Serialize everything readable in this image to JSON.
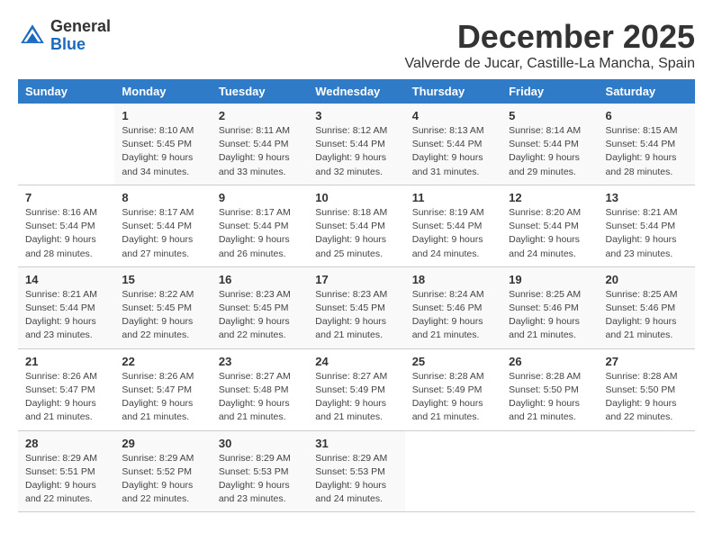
{
  "header": {
    "logo_general": "General",
    "logo_blue": "Blue",
    "month": "December 2025",
    "location": "Valverde de Jucar, Castille-La Mancha, Spain"
  },
  "days_of_week": [
    "Sunday",
    "Monday",
    "Tuesday",
    "Wednesday",
    "Thursday",
    "Friday",
    "Saturday"
  ],
  "weeks": [
    [
      {
        "day": "",
        "info": ""
      },
      {
        "day": "1",
        "info": "Sunrise: 8:10 AM\nSunset: 5:45 PM\nDaylight: 9 hours\nand 34 minutes."
      },
      {
        "day": "2",
        "info": "Sunrise: 8:11 AM\nSunset: 5:44 PM\nDaylight: 9 hours\nand 33 minutes."
      },
      {
        "day": "3",
        "info": "Sunrise: 8:12 AM\nSunset: 5:44 PM\nDaylight: 9 hours\nand 32 minutes."
      },
      {
        "day": "4",
        "info": "Sunrise: 8:13 AM\nSunset: 5:44 PM\nDaylight: 9 hours\nand 31 minutes."
      },
      {
        "day": "5",
        "info": "Sunrise: 8:14 AM\nSunset: 5:44 PM\nDaylight: 9 hours\nand 29 minutes."
      },
      {
        "day": "6",
        "info": "Sunrise: 8:15 AM\nSunset: 5:44 PM\nDaylight: 9 hours\nand 28 minutes."
      }
    ],
    [
      {
        "day": "7",
        "info": "Sunrise: 8:16 AM\nSunset: 5:44 PM\nDaylight: 9 hours\nand 28 minutes."
      },
      {
        "day": "8",
        "info": "Sunrise: 8:17 AM\nSunset: 5:44 PM\nDaylight: 9 hours\nand 27 minutes."
      },
      {
        "day": "9",
        "info": "Sunrise: 8:17 AM\nSunset: 5:44 PM\nDaylight: 9 hours\nand 26 minutes."
      },
      {
        "day": "10",
        "info": "Sunrise: 8:18 AM\nSunset: 5:44 PM\nDaylight: 9 hours\nand 25 minutes."
      },
      {
        "day": "11",
        "info": "Sunrise: 8:19 AM\nSunset: 5:44 PM\nDaylight: 9 hours\nand 24 minutes."
      },
      {
        "day": "12",
        "info": "Sunrise: 8:20 AM\nSunset: 5:44 PM\nDaylight: 9 hours\nand 24 minutes."
      },
      {
        "day": "13",
        "info": "Sunrise: 8:21 AM\nSunset: 5:44 PM\nDaylight: 9 hours\nand 23 minutes."
      }
    ],
    [
      {
        "day": "14",
        "info": "Sunrise: 8:21 AM\nSunset: 5:44 PM\nDaylight: 9 hours\nand 23 minutes."
      },
      {
        "day": "15",
        "info": "Sunrise: 8:22 AM\nSunset: 5:45 PM\nDaylight: 9 hours\nand 22 minutes."
      },
      {
        "day": "16",
        "info": "Sunrise: 8:23 AM\nSunset: 5:45 PM\nDaylight: 9 hours\nand 22 minutes."
      },
      {
        "day": "17",
        "info": "Sunrise: 8:23 AM\nSunset: 5:45 PM\nDaylight: 9 hours\nand 21 minutes."
      },
      {
        "day": "18",
        "info": "Sunrise: 8:24 AM\nSunset: 5:46 PM\nDaylight: 9 hours\nand 21 minutes."
      },
      {
        "day": "19",
        "info": "Sunrise: 8:25 AM\nSunset: 5:46 PM\nDaylight: 9 hours\nand 21 minutes."
      },
      {
        "day": "20",
        "info": "Sunrise: 8:25 AM\nSunset: 5:46 PM\nDaylight: 9 hours\nand 21 minutes."
      }
    ],
    [
      {
        "day": "21",
        "info": "Sunrise: 8:26 AM\nSunset: 5:47 PM\nDaylight: 9 hours\nand 21 minutes."
      },
      {
        "day": "22",
        "info": "Sunrise: 8:26 AM\nSunset: 5:47 PM\nDaylight: 9 hours\nand 21 minutes."
      },
      {
        "day": "23",
        "info": "Sunrise: 8:27 AM\nSunset: 5:48 PM\nDaylight: 9 hours\nand 21 minutes."
      },
      {
        "day": "24",
        "info": "Sunrise: 8:27 AM\nSunset: 5:49 PM\nDaylight: 9 hours\nand 21 minutes."
      },
      {
        "day": "25",
        "info": "Sunrise: 8:28 AM\nSunset: 5:49 PM\nDaylight: 9 hours\nand 21 minutes."
      },
      {
        "day": "26",
        "info": "Sunrise: 8:28 AM\nSunset: 5:50 PM\nDaylight: 9 hours\nand 21 minutes."
      },
      {
        "day": "27",
        "info": "Sunrise: 8:28 AM\nSunset: 5:50 PM\nDaylight: 9 hours\nand 22 minutes."
      }
    ],
    [
      {
        "day": "28",
        "info": "Sunrise: 8:29 AM\nSunset: 5:51 PM\nDaylight: 9 hours\nand 22 minutes."
      },
      {
        "day": "29",
        "info": "Sunrise: 8:29 AM\nSunset: 5:52 PM\nDaylight: 9 hours\nand 22 minutes."
      },
      {
        "day": "30",
        "info": "Sunrise: 8:29 AM\nSunset: 5:53 PM\nDaylight: 9 hours\nand 23 minutes."
      },
      {
        "day": "31",
        "info": "Sunrise: 8:29 AM\nSunset: 5:53 PM\nDaylight: 9 hours\nand 24 minutes."
      },
      {
        "day": "",
        "info": ""
      },
      {
        "day": "",
        "info": ""
      },
      {
        "day": "",
        "info": ""
      }
    ]
  ]
}
